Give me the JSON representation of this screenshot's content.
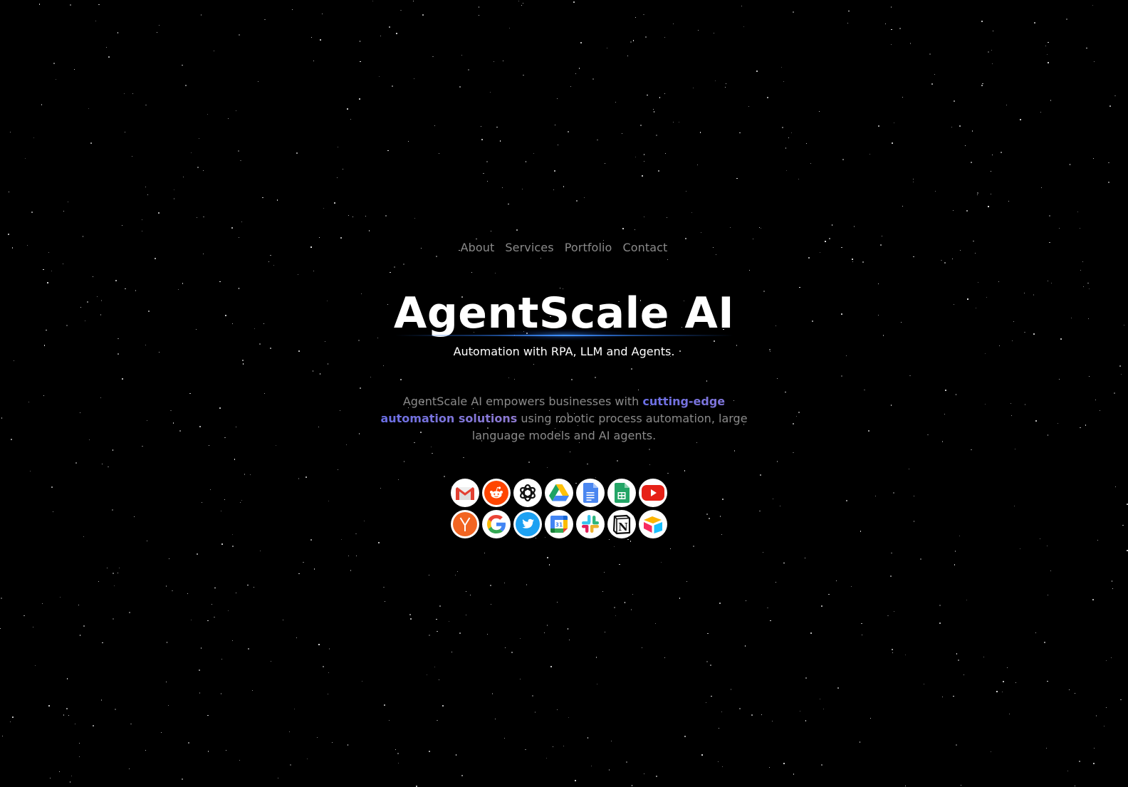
{
  "nav": {
    "items": [
      {
        "label": "About"
      },
      {
        "label": "Services"
      },
      {
        "label": "Portfolio"
      },
      {
        "label": "Contact"
      }
    ]
  },
  "hero": {
    "title": "AgentScale AI",
    "subtitle": "Automation with RPA, LLM and Agents.",
    "description": {
      "before": "AgentScale AI empowers businesses with ",
      "highlight": "cutting-edge automation solutions",
      "after": " using robotic process automation, large language models and AI agents."
    }
  },
  "integrations": [
    {
      "name": "Gmail",
      "icon": "gmail-icon"
    },
    {
      "name": "Reddit",
      "icon": "reddit-icon"
    },
    {
      "name": "OpenAI",
      "icon": "openai-icon"
    },
    {
      "name": "Google Drive",
      "icon": "google-drive-icon"
    },
    {
      "name": "Google Docs",
      "icon": "google-docs-icon"
    },
    {
      "name": "Google Sheets",
      "icon": "google-sheets-icon"
    },
    {
      "name": "YouTube",
      "icon": "youtube-icon"
    },
    {
      "name": "Y Combinator",
      "icon": "ycombinator-icon"
    },
    {
      "name": "Google",
      "icon": "google-icon"
    },
    {
      "name": "Twitter",
      "icon": "twitter-icon"
    },
    {
      "name": "Google Calendar",
      "icon": "google-calendar-icon",
      "text": "31"
    },
    {
      "name": "Slack",
      "icon": "slack-icon"
    },
    {
      "name": "Notion",
      "icon": "notion-icon",
      "text": "N"
    },
    {
      "name": "Airtable",
      "icon": "airtable-icon"
    }
  ],
  "theme": {
    "background": "#000000",
    "nav_text": "#8a8a8a",
    "title_text": "#ffffff",
    "glow": "#3d8fff",
    "highlight_start": "#6b6fe6",
    "highlight_end": "#ef7a2e"
  }
}
